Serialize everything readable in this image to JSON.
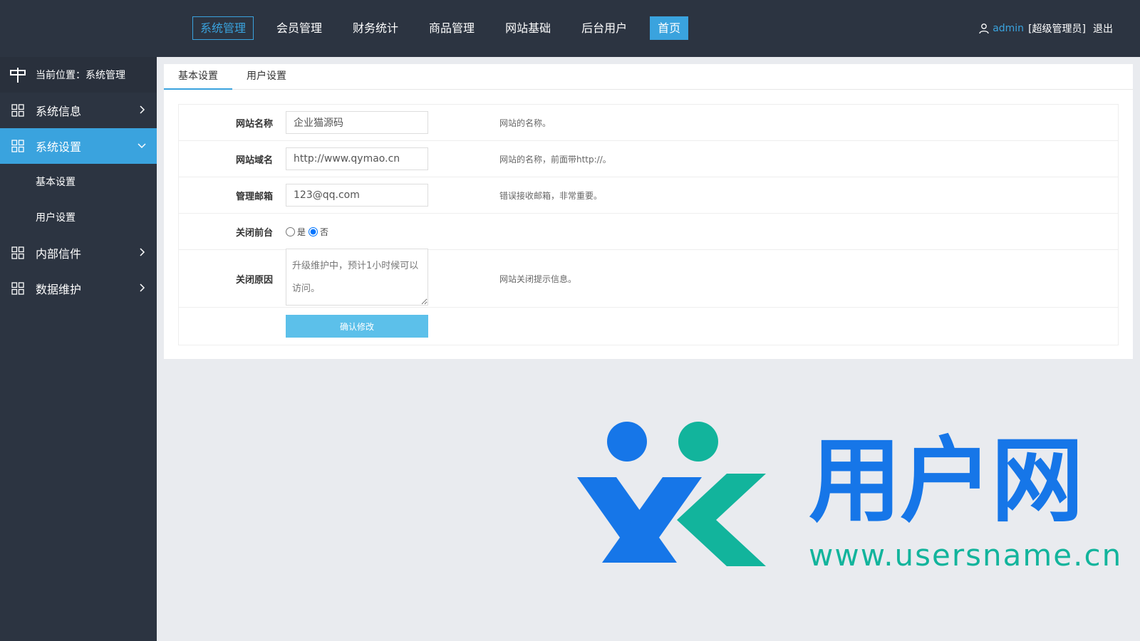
{
  "topnav": {
    "items": [
      "系统管理",
      "会员管理",
      "财务统计",
      "商品管理",
      "网站基础",
      "后台用户",
      "首页"
    ],
    "active_index": 0
  },
  "user": {
    "name": "admin",
    "role": "[超级管理员]",
    "logout": "退出"
  },
  "sidebar": {
    "crumb": "当前位置：系统管理",
    "items": [
      {
        "label": "系统信息"
      },
      {
        "label": "系统设置",
        "sub": [
          "基本设置",
          "用户设置"
        ]
      },
      {
        "label": "内部信件"
      },
      {
        "label": "数据维护"
      }
    ]
  },
  "tabs": [
    "基本设置",
    "用户设置"
  ],
  "form": {
    "site_name": {
      "label": "网站名称",
      "value": "企业猫源码",
      "hint": "网站的名称。"
    },
    "site_domain": {
      "label": "网站域名",
      "value": "http://www.qymao.cn",
      "hint": "网站的名称，前面带http://。"
    },
    "admin_email": {
      "label": "管理邮箱",
      "value": "123@qq.com",
      "hint": "错误接收邮箱，非常重要。"
    },
    "close_front": {
      "label": "关闭前台",
      "options": [
        "是",
        "否"
      ],
      "selected": "否"
    },
    "close_reason": {
      "label": "关闭原因",
      "value": "升级维护中，预计1小时候可以访问。",
      "hint": "网站关闭提示信息。"
    },
    "submit": "确认修改"
  },
  "watermark": {
    "brand": "用户网",
    "url": "www.usersname.cn"
  },
  "colors": {
    "dark_bg": "#2c3441",
    "accent": "#3aa3de",
    "logo_blue": "#1676e8",
    "logo_green": "#12b49c"
  }
}
